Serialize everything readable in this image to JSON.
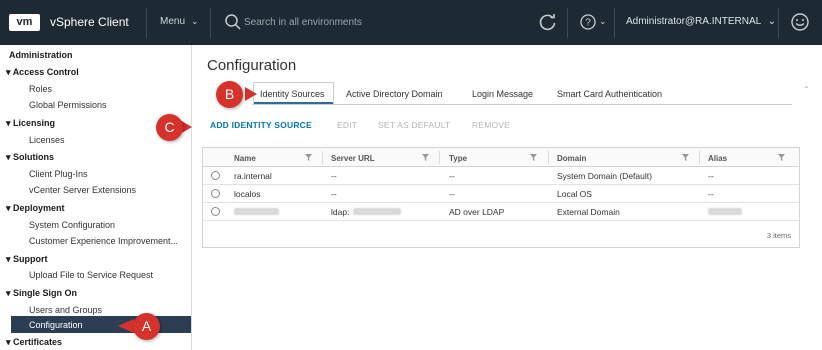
{
  "topbar": {
    "logo": "vm",
    "app_title": "vSphere Client",
    "menu_label": "Menu",
    "search_placeholder": "Search in all environments",
    "user_label": "Administrator@RA.INTERNAL"
  },
  "sidebar": {
    "title": "Administration",
    "groups": [
      {
        "label": "Access Control",
        "items": [
          "Roles",
          "Global Permissions"
        ]
      },
      {
        "label": "Licensing",
        "items": [
          "Licenses"
        ]
      },
      {
        "label": "Solutions",
        "items": [
          "Client Plug-Ins",
          "vCenter Server Extensions"
        ]
      },
      {
        "label": "Deployment",
        "items": [
          "System Configuration",
          "Customer Experience Improvement..."
        ]
      },
      {
        "label": "Support",
        "items": [
          "Upload File to Service Request"
        ]
      },
      {
        "label": "Single Sign On",
        "items": [
          "Users and Groups",
          "Configuration"
        ]
      },
      {
        "label": "Certificates",
        "items": []
      }
    ],
    "active_item": "Configuration"
  },
  "main": {
    "title": "Configuration",
    "tabs": [
      "Identity Sources",
      "Active Directory Domain",
      "Login Message",
      "Smart Card Authentication"
    ],
    "active_tab": "Identity Sources",
    "toolbar": {
      "add": "ADD IDENTITY SOURCE",
      "edit": "EDIT",
      "set_default": "SET AS DEFAULT",
      "remove": "REMOVE"
    },
    "table": {
      "columns": [
        "Name",
        "Server URL",
        "Type",
        "Domain",
        "Alias"
      ],
      "rows": [
        {
          "name": "ra.internal",
          "server_url": "--",
          "type": "--",
          "domain": "System Domain (Default)",
          "alias": "--"
        },
        {
          "name": "localos",
          "server_url": "--",
          "type": "--",
          "domain": "Local OS",
          "alias": "--"
        },
        {
          "name": "",
          "server_url": "ldap:",
          "type": "AD over LDAP",
          "domain": "External Domain",
          "alias": ""
        }
      ],
      "footer": "3 items"
    }
  },
  "callouts": {
    "a": "A",
    "b": "B",
    "c": "C"
  },
  "colors": {
    "topbar": "#1e2a33",
    "accent": "#0079b8",
    "selected": "#2b3e53",
    "callout": "#d6322c"
  }
}
